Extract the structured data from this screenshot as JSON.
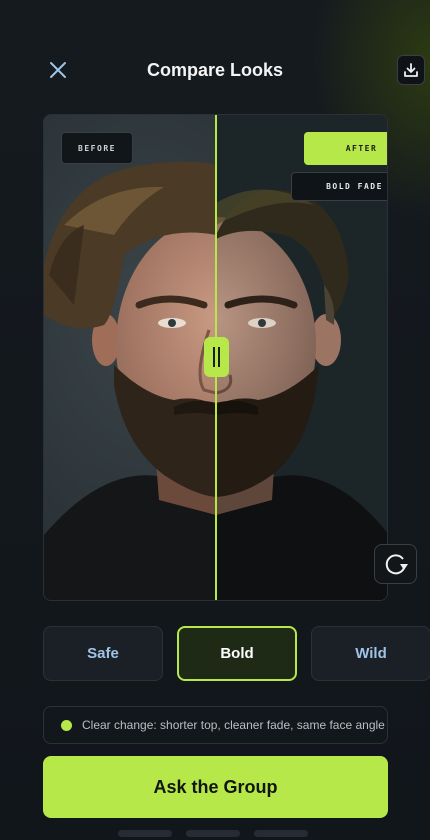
{
  "header": {
    "title": "Compare Looks",
    "close_icon": "close-icon",
    "download_icon": "download-icon"
  },
  "compare": {
    "before_label": "BEFORE",
    "after_label": "AFTER",
    "style_label": "BOLD FADE",
    "slider_position": 0.5,
    "rotate_icon": "rotate-icon"
  },
  "options": [
    {
      "label": "Safe",
      "selected": false
    },
    {
      "label": "Bold",
      "selected": true
    },
    {
      "label": "Wild",
      "selected": false
    }
  ],
  "note": {
    "text": "Clear change: shorter top, cleaner fade, same face angle"
  },
  "cta": {
    "label": "Ask the Group"
  },
  "pager": {
    "count": 3
  },
  "colors": {
    "accent": "#b6e84a",
    "background": "#11161b",
    "muted_text": "#9ec3e6"
  }
}
